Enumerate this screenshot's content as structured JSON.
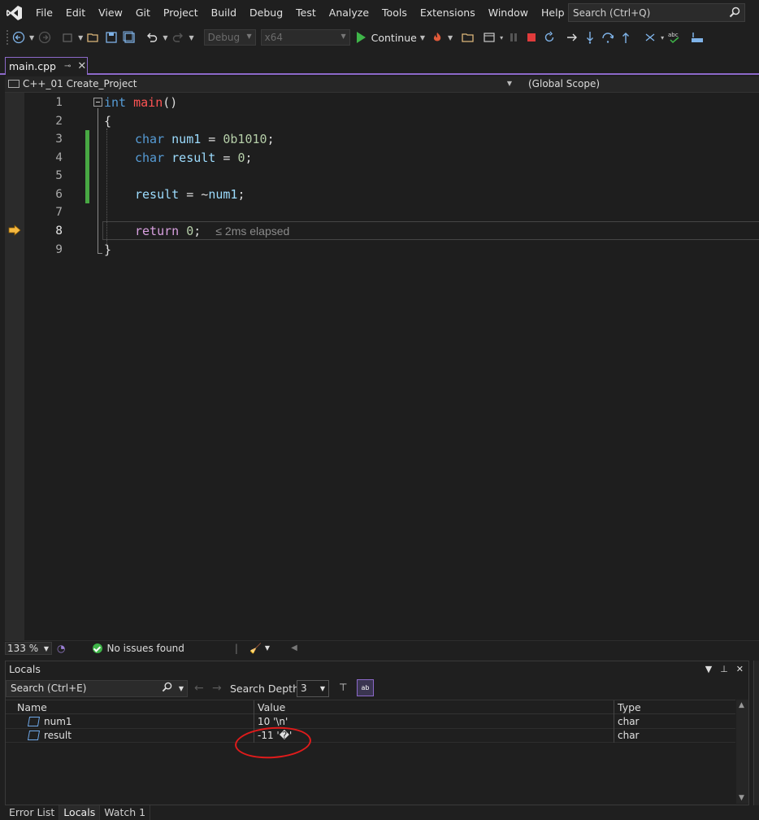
{
  "menu": {
    "items": [
      "File",
      "Edit",
      "View",
      "Git",
      "Project",
      "Build",
      "Debug",
      "Test",
      "Analyze",
      "Tools",
      "Extensions",
      "Window",
      "Help"
    ],
    "search_placeholder": "Search (Ctrl+Q)"
  },
  "toolbar": {
    "config": "Debug",
    "platform": "x64",
    "continue_label": "Continue"
  },
  "document_tab": {
    "filename": "main.cpp"
  },
  "navbar": {
    "project": "C++_01 Create_Project",
    "scope": "(Global Scope)"
  },
  "editor": {
    "line_numbers": [
      "1",
      "2",
      "3",
      "4",
      "5",
      "6",
      "7",
      "8",
      "9"
    ],
    "current_line": "8",
    "lines": {
      "l1_kw": "int",
      "l1_fn": "main",
      "l1_rest": "()",
      "l2": "{",
      "l3_kw": "char",
      "l3_id": "num1",
      "l3_op": " = ",
      "l3_num": "0b1010",
      "l3_end": ";",
      "l4_kw": "char",
      "l4_id": "result",
      "l4_op": " = ",
      "l4_num": "0",
      "l4_end": ";",
      "l6_id1": "result",
      "l6_op": " = ~",
      "l6_id2": "num1",
      "l6_end": ";",
      "l8_kw": "return",
      "l8_num": "0",
      "l8_end": ";",
      "l8_elapsed": "≤ 2ms elapsed",
      "l9": "}"
    }
  },
  "status": {
    "zoom": "133 %",
    "issues": "No issues found"
  },
  "locals": {
    "title": "Locals",
    "search_placeholder": "Search (Ctrl+E)",
    "depth_label": "Search Depth:",
    "depth_value": "3",
    "columns": {
      "name": "Name",
      "value": "Value",
      "type": "Type"
    },
    "rows": [
      {
        "name": "num1",
        "value": "10 '\\n'",
        "type": "char"
      },
      {
        "name": "result",
        "value": "-11 '�'",
        "type": "char"
      }
    ]
  },
  "bottom_tabs": [
    "Error List",
    "Locals",
    "Watch 1"
  ],
  "colors": {
    "accent": "#8c69c9",
    "annotation_red": "#e01b1b",
    "change_bar": "#48a843"
  }
}
